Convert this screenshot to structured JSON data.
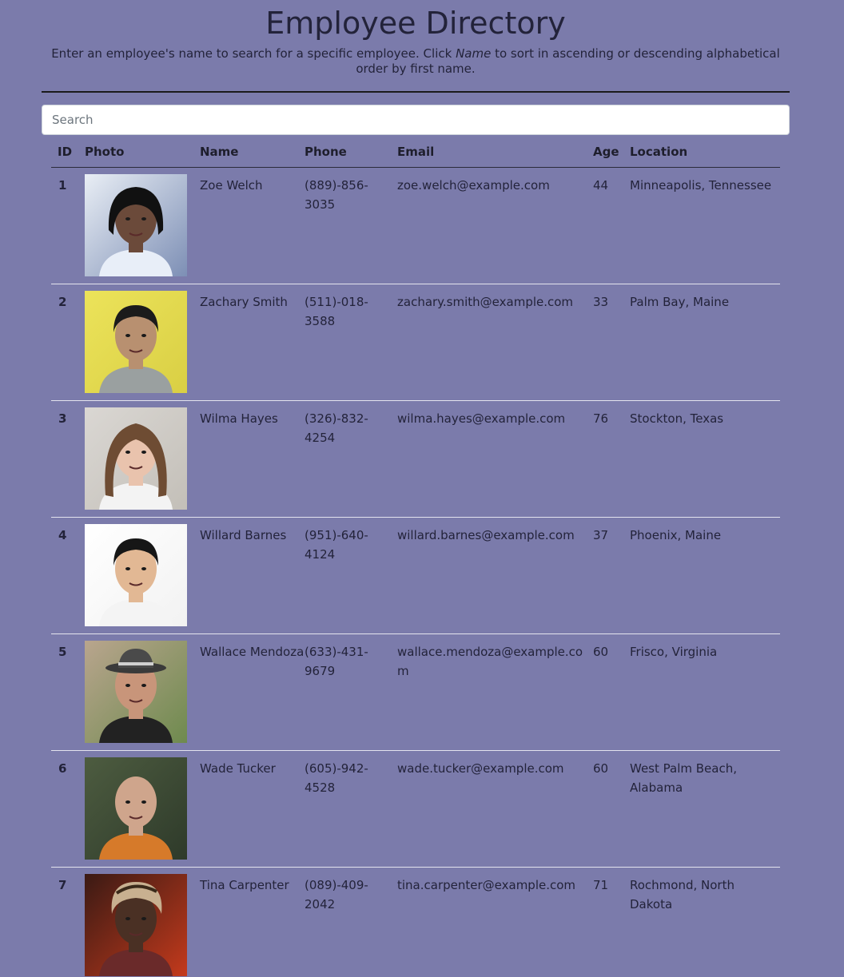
{
  "header": {
    "title": "Employee Directory",
    "subtitle_before": "Enter an employee's name to search for a specific employee. Click ",
    "subtitle_emphasis": "Name",
    "subtitle_after": " to sort in ascending or descending alphabetical order by first name."
  },
  "search": {
    "placeholder": "Search",
    "value": ""
  },
  "table": {
    "columns": {
      "id": "ID",
      "photo": "Photo",
      "name": "Name",
      "phone": "Phone",
      "email": "Email",
      "age": "Age",
      "location": "Location"
    },
    "rows": [
      {
        "id": "1",
        "name": "Zoe Welch",
        "phone": "(889)-856-3035",
        "email": "zoe.welch@example.com",
        "age": "44",
        "location": "Minneapolis, Tennessee"
      },
      {
        "id": "2",
        "name": "Zachary Smith",
        "phone": "(511)-018-3588",
        "email": "zachary.smith@example.com",
        "age": "33",
        "location": "Palm Bay, Maine"
      },
      {
        "id": "3",
        "name": "Wilma Hayes",
        "phone": "(326)-832-4254",
        "email": "wilma.hayes@example.com",
        "age": "76",
        "location": "Stockton, Texas"
      },
      {
        "id": "4",
        "name": "Willard Barnes",
        "phone": "(951)-640-4124",
        "email": "willard.barnes@example.com",
        "age": "37",
        "location": "Phoenix, Maine"
      },
      {
        "id": "5",
        "name": "Wallace Mendoza",
        "phone": "(633)-431-9679",
        "email": "wallace.mendoza@example.com",
        "age": "60",
        "location": "Frisco, Virginia"
      },
      {
        "id": "6",
        "name": "Wade Tucker",
        "phone": "(605)-942-4528",
        "email": "wade.tucker@example.com",
        "age": "60",
        "location": "West Palm Beach, Alabama"
      },
      {
        "id": "7",
        "name": "Tina Carpenter",
        "phone": "(089)-409-2042",
        "email": "tina.carpenter@example.com",
        "age": "71",
        "location": "Rochmond, North Dakota"
      }
    ]
  }
}
